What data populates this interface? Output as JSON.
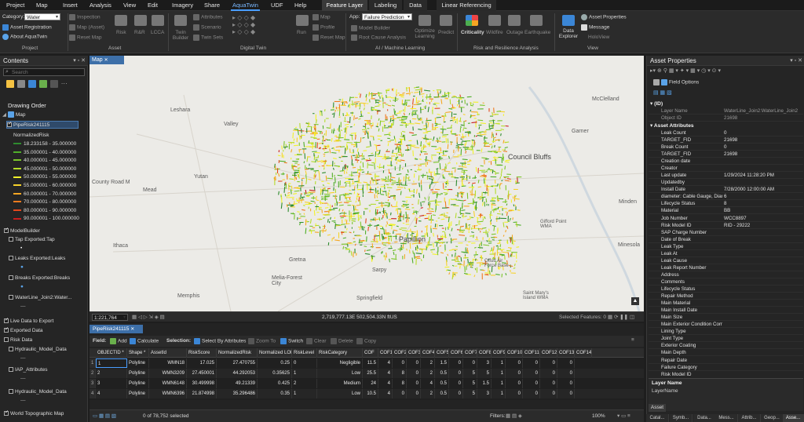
{
  "menubar": {
    "items": [
      "Project",
      "Map",
      "Insert",
      "Analysis",
      "View",
      "Edit",
      "Imagery",
      "Share",
      "AquaTwin",
      "UDF",
      "Help"
    ],
    "active": "AquaTwin",
    "context_tabs": [
      "Feature Layer",
      "Labeling",
      "Data",
      "Linear Referencing"
    ]
  },
  "ribbon": {
    "project": {
      "category_label": "Category:",
      "category_value": "Water",
      "asset_registration": "Asset Registration",
      "about": "About AquaTwin",
      "title": "Project"
    },
    "asset": {
      "inspection": "Inspection",
      "map_asset": "Map (Asset)",
      "reset_map": "Reset Map",
      "risk": "Risk",
      "rnr": "R&R",
      "lcca": "LCCA",
      "title": "Asset"
    },
    "digital_twin": {
      "twin_builder": "Twin Builder",
      "attributes": "Attributes",
      "scenario": "Scenario",
      "twin_sets": "Twin Sets",
      "run": "Run",
      "map": "Map",
      "profile": "Profile",
      "reset_map": "Reset Map",
      "title": "Digital Twin"
    },
    "ai": {
      "app_label": "App:",
      "app_value": "Failure Prediction",
      "model_builder": "Model Builder",
      "root_cause": "Root Cause Analysis",
      "optimize_learning": "Optimize Learning",
      "predict": "Predict",
      "title": "AI / Machine Learning"
    },
    "risk": {
      "criticality": "Criticality",
      "wildfire": "Wildfire",
      "outage": "Outage",
      "earthquake": "Earthquake",
      "title": "Risk and Resilience Analysis"
    },
    "view": {
      "data_explorer": "Data Explorer",
      "asset_properties": "Asset Properties",
      "message": "Message",
      "holoview": "HoloView",
      "title": "View"
    }
  },
  "contents": {
    "title": "Contents",
    "search_placeholder": "Search",
    "drawing_order": "Drawing Order",
    "map_label": "Map",
    "layer": "PipeRisk241115",
    "field": "NormalizedRisk",
    "legend": [
      {
        "label": "18.233158 - 35.000000",
        "color": "#2e8b2e"
      },
      {
        "label": "35.000001 - 40.000000",
        "color": "#4fae2a"
      },
      {
        "label": "40.000001 - 45.000000",
        "color": "#7cc62a"
      },
      {
        "label": "45.000001 - 50.000000",
        "color": "#b4dc2a"
      },
      {
        "label": "50.000001 - 55.000000",
        "color": "#f2f22a"
      },
      {
        "label": "55.000001 - 60.000000",
        "color": "#f7d22a"
      },
      {
        "label": "60.000001 - 70.000000",
        "color": "#f5a623"
      },
      {
        "label": "70.000001 - 80.000000",
        "color": "#ef7a1f"
      },
      {
        "label": "80.000001 - 90.000000",
        "color": "#e4481c"
      },
      {
        "label": "90.000001 - 100.000000",
        "color": "#c81e1e"
      }
    ],
    "modelbuilder": "ModelBuilder",
    "tap_exported": "Tap Exported:Tap",
    "leaks_exported": "Leaks Exported:Leaks",
    "breaks_exported": "Breaks Exported:Breaks",
    "waterline_join": "WaterLine_Join2:Water...",
    "live_data": "Live Data to Export",
    "exported_data": "Exported Data",
    "risk_data": "Risk Data",
    "hydraulic1": "Hydraulic_Model_Data",
    "iap": "IAP_Attributes",
    "hydraulic2": "Hydraulic_Model_Data",
    "world_topo": "World Topographic Map"
  },
  "map": {
    "tab": "Map",
    "labels": {
      "leshara": "Leshara",
      "valley": "Valley",
      "yutan": "Yutan",
      "mead": "Mead",
      "county_road": "County Road M",
      "ithaca": "Ithaca",
      "memphis": "Memphis",
      "gretna": "Gretna",
      "melia": "Melia-Forest City",
      "springfield": "Springfield",
      "papillion": "Papillion",
      "sarpy": "Sarpy",
      "council_bluffs": "Council Bluffs",
      "mcclelland": "McClelland",
      "garner": "Garner",
      "minden": "Minden",
      "offutt": "Offutt Air Force Base",
      "gifford": "Gifford Point WMA",
      "st_marys": "Saint Mary's Island WMA",
      "minesola": "Minesola"
    },
    "scale": "1:221,764",
    "coords": "2,719,777.13E 502,504.33N ftUS",
    "selected_features": "Selected Features: 0"
  },
  "table": {
    "tab": "PipeRisk241115",
    "toolbar": {
      "field": "Field:",
      "add": "Add",
      "calculate": "Calculate",
      "selection": "Selection:",
      "select_by_attr": "Select By Attributes",
      "zoom_to": "Zoom To",
      "switch": "Switch",
      "clear": "Clear",
      "delete": "Delete",
      "copy": "Copy"
    },
    "columns": [
      "OBJECTID *",
      "Shape *",
      "AssetId",
      "RiskScore",
      "NormalizedRisk",
      "Normalized LOF",
      "RiskLevel",
      "RiskCategory",
      "COF",
      "COF1",
      "COF2",
      "COF3",
      "COF4",
      "COF5",
      "COF6",
      "COF7",
      "COF8",
      "COF9",
      "COF10",
      "COF11",
      "COF12",
      "COF13",
      "COF14"
    ],
    "rows": [
      [
        "1",
        "1",
        "Polyline",
        "WMN18",
        "17.025",
        "27.470755",
        "0.25",
        "0",
        "Negligible",
        "11.5",
        "4",
        "0",
        "0",
        "2",
        "1.5",
        "0",
        "0",
        "3",
        "1",
        "0",
        "0",
        "0",
        "0"
      ],
      [
        "2",
        "2",
        "Polyline",
        "WMN3209",
        "27.450001",
        "44.292053",
        "0.35625",
        "1",
        "Low",
        "25.5",
        "4",
        "8",
        "0",
        "2",
        "0.5",
        "0",
        "5",
        "5",
        "1",
        "0",
        "0",
        "0",
        "0"
      ],
      [
        "3",
        "3",
        "Polyline",
        "WMN6148",
        "30.499998",
        "49.21339",
        "0.425",
        "2",
        "Medium",
        "24",
        "4",
        "8",
        "0",
        "4",
        "0.5",
        "0",
        "5",
        "1.5",
        "1",
        "0",
        "0",
        "0",
        "0"
      ],
      [
        "4",
        "4",
        "Polyline",
        "WMN6396",
        "21.874998",
        "35.296486",
        "0.35",
        "1",
        "Low",
        "10.5",
        "4",
        "0",
        "0",
        "2",
        "0.5",
        "0",
        "5",
        "3",
        "1",
        "0",
        "0",
        "0",
        "0"
      ]
    ],
    "status": "0 of 78,752 selected",
    "filters": "Filters:",
    "zoom": "100%"
  },
  "props": {
    "title": "Asset Properties",
    "field_options": "Field Options",
    "id_header": "(ID)",
    "id_rows": [
      {
        "k": "Layer Name",
        "v": "WaterLine_Join2:WaterLine_Join2"
      },
      {
        "k": "Object ID",
        "v": "21698"
      }
    ],
    "attr_header": "Asset Attributes",
    "attrs": [
      {
        "k": "Leak Count",
        "v": "0"
      },
      {
        "k": "TARGET_FID",
        "v": "21698"
      },
      {
        "k": "Break Count",
        "v": "0"
      },
      {
        "k": "TARGET_FID",
        "v": "21698"
      },
      {
        "k": "Creation date",
        "v": ""
      },
      {
        "k": "Creator",
        "v": ""
      },
      {
        "k": "Last update",
        "v": "1/29/2024 11:28:20 PM"
      },
      {
        "k": "Updatedby",
        "v": ""
      },
      {
        "k": "Install Date",
        "v": "7/28/2000 12:00:00 AM"
      },
      {
        "k": "diameter: Cable Gauge, Diar",
        "v": "6"
      },
      {
        "k": "Lifecycle Status",
        "v": "8"
      },
      {
        "k": "Material",
        "v": "BB"
      },
      {
        "k": "Job Number",
        "v": "WCC8897"
      },
      {
        "k": "Risk Model ID",
        "v": "RID - 29222"
      },
      {
        "k": "SAP Charge Number",
        "v": ""
      },
      {
        "k": "Date of Break",
        "v": ""
      },
      {
        "k": "Leak Type",
        "v": ""
      },
      {
        "k": "Leak At",
        "v": ""
      },
      {
        "k": "Leak Cause",
        "v": ""
      },
      {
        "k": "Leak Report Number",
        "v": ""
      },
      {
        "k": "Address",
        "v": ""
      },
      {
        "k": "Comments",
        "v": ""
      },
      {
        "k": "Lifecycle Status",
        "v": ""
      },
      {
        "k": "Repair Method",
        "v": ""
      },
      {
        "k": "Main Material",
        "v": ""
      },
      {
        "k": "Main Install Date",
        "v": ""
      },
      {
        "k": "Main Size",
        "v": ""
      },
      {
        "k": "Main Exterior Condition Com",
        "v": ""
      },
      {
        "k": "Lining Type",
        "v": ""
      },
      {
        "k": "Joint Type",
        "v": ""
      },
      {
        "k": "Exterior Coating",
        "v": ""
      },
      {
        "k": "Main Depth",
        "v": ""
      },
      {
        "k": "Repair Date",
        "v": ""
      },
      {
        "k": "Failure Category",
        "v": ""
      },
      {
        "k": "Risk Model ID",
        "v": ""
      }
    ],
    "layer_name_title": "Layer Name",
    "layer_name_value": "LayerName",
    "asset_tab": "Asset",
    "bottom_tabs": [
      "Catal...",
      "Symb...",
      "Data...",
      "Mess...",
      "Attrib...",
      "Geop...",
      "Asse..."
    ]
  }
}
